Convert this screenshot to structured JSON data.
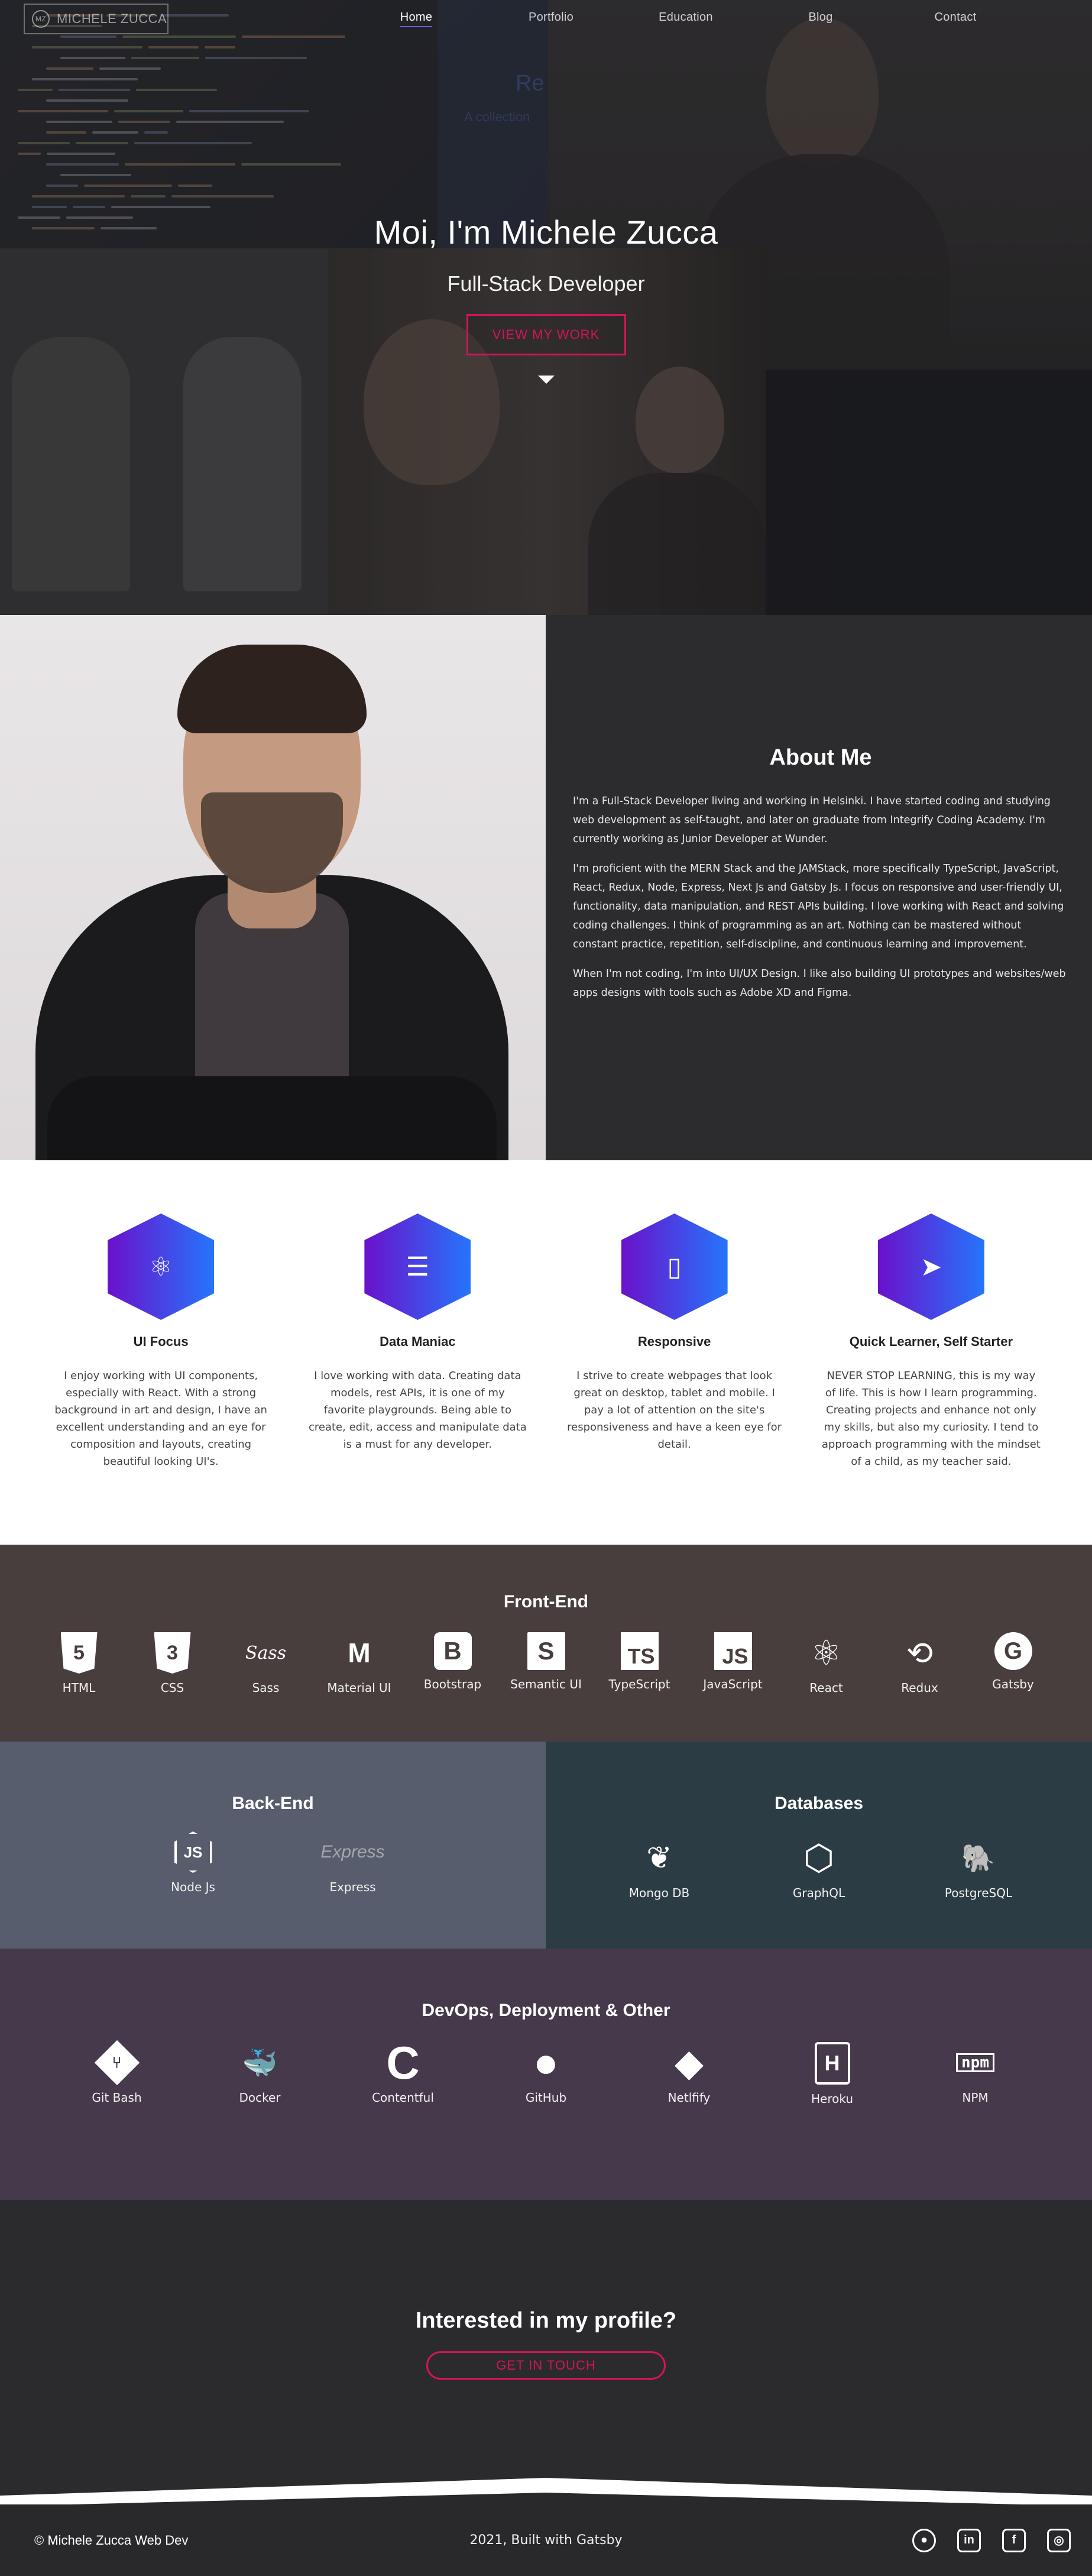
{
  "nav": {
    "logo": "MICHELE ZUCCA",
    "links": [
      "Home",
      "Portfolio",
      "Education",
      "Blog",
      "Contact"
    ]
  },
  "hero": {
    "title": "Moi, I'm Michele Zucca",
    "subtitle": "Full-Stack Developer",
    "button": "VIEW MY WORK",
    "ghost_title": "Re",
    "ghost_sub": "A collection"
  },
  "about": {
    "title": "About Me",
    "paragraphs": [
      "I'm a Full-Stack Developer living and working in Helsinki. I have started coding and studying web development as self-taught, and later on graduate from Integrify Coding Academy. I'm currently working as Junior Developer at Wunder.",
      "I'm proficient with the MERN Stack and the JAMStack, more specifically TypeScript, JavaScript, React, Redux, Node, Express, Next Js and Gatsby Js. I focus on responsive and user-friendly UI, functionality, data manipulation, and REST APIs building. I love working with React and solving coding challenges. I think of programming as an art. Nothing can be mastered without constant practice, repetition, self-discipline, and continuous learning and improvement.",
      "When I'm not coding, I'm into UI/UX Design. I like also building UI prototypes and websites/web apps designs with tools such as Adobe XD and Figma."
    ]
  },
  "features": [
    {
      "icon": "react-icon",
      "glyph": "⚛",
      "title": "UI Focus",
      "text": "I enjoy working with UI components, especially with React. With a strong background in art and design, I have an excellent understanding and an eye for composition and layouts, creating beautiful looking UI's."
    },
    {
      "icon": "database-icon",
      "glyph": "☰",
      "title": "Data Maniac",
      "text": "I love working with data. Creating data models, rest APIs, it is one of my favorite playgrounds. Being able to create, edit, access and manipulate data is a must for any developer."
    },
    {
      "icon": "mobile-icon",
      "glyph": "▯",
      "title": "Responsive",
      "text": "I strive to create webpages that look great on desktop, tablet and mobile. I pay a lot of attention on the site's responsiveness and have a keen eye for detail."
    },
    {
      "icon": "running-icon",
      "glyph": "➤",
      "title": "Quick Learner, Self Starter",
      "text": "NEVER STOP LEARNING, this is my way of life. This is how I learn programming. Creating projects and enhance not only my skills, but also my curiosity. I tend to approach programming with the mindset of a child, as my teacher said."
    }
  ],
  "frontend": {
    "title": "Front-End",
    "items": [
      {
        "icon": "html5-icon",
        "glyph": "5",
        "label": "HTML"
      },
      {
        "icon": "css3-icon",
        "glyph": "3",
        "label": "CSS"
      },
      {
        "icon": "sass-icon",
        "glyph": "Sass",
        "label": "Sass"
      },
      {
        "icon": "material-ui-icon",
        "glyph": "M",
        "label": "Material UI"
      },
      {
        "icon": "bootstrap-icon",
        "glyph": "B",
        "label": "Bootstrap"
      },
      {
        "icon": "semantic-ui-icon",
        "glyph": "S",
        "label": "Semantic UI"
      },
      {
        "icon": "typescript-icon",
        "glyph": "TS",
        "label": "TypeScript"
      },
      {
        "icon": "javascript-icon",
        "glyph": "JS",
        "label": "JavaScript"
      },
      {
        "icon": "react-icon",
        "glyph": "⚛",
        "label": "React"
      },
      {
        "icon": "redux-icon",
        "glyph": "⟲",
        "label": "Redux"
      },
      {
        "icon": "gatsby-icon",
        "glyph": "G",
        "label": "Gatsby"
      }
    ]
  },
  "backend": {
    "title": "Back-End",
    "items": [
      {
        "icon": "nodejs-icon",
        "glyph": "JS",
        "label": "Node Js"
      },
      {
        "icon": "express-icon",
        "glyph": "Express",
        "label": "Express"
      }
    ]
  },
  "databases": {
    "title": "Databases",
    "items": [
      {
        "icon": "mongodb-icon",
        "glyph": "❦",
        "label": "Mongo DB"
      },
      {
        "icon": "graphql-icon",
        "glyph": "⬡",
        "label": "GraphQL"
      },
      {
        "icon": "postgresql-icon",
        "glyph": "🐘",
        "label": "PostgreSQL"
      }
    ]
  },
  "devops": {
    "title": "DevOps, Deployment & Other",
    "items": [
      {
        "icon": "git-icon",
        "glyph": "⑂",
        "label": "Git Bash"
      },
      {
        "icon": "docker-icon",
        "glyph": "🐳",
        "label": "Docker"
      },
      {
        "icon": "contentful-icon",
        "glyph": "C",
        "label": "Contentful"
      },
      {
        "icon": "github-icon",
        "glyph": "●",
        "label": "GitHub"
      },
      {
        "icon": "netlify-icon",
        "glyph": "◆",
        "label": "Netlfify"
      },
      {
        "icon": "heroku-icon",
        "glyph": "H",
        "label": "Heroku"
      },
      {
        "icon": "npm-icon",
        "glyph": "npm",
        "label": "NPM"
      }
    ]
  },
  "contact": {
    "title": "Interested in my profile?",
    "button": "GET IN TOUCH"
  },
  "footer": {
    "copyright": "© Michele Zucca Web Dev",
    "built": "2021, Built with Gatsby",
    "social": [
      {
        "icon": "github-icon",
        "glyph": "●"
      },
      {
        "icon": "linkedin-icon",
        "glyph": "in"
      },
      {
        "icon": "facebook-icon",
        "glyph": "f"
      },
      {
        "icon": "instagram-icon",
        "glyph": "◎"
      }
    ]
  },
  "colors": {
    "accent": "#d4145a",
    "hex_gradient_start": "#6a11cb",
    "hex_gradient_end": "#2575fc",
    "frontend_bg": "#483e3d",
    "backend_bg": "#575d6c",
    "databases_bg": "#2c3c44",
    "devops_bg": "#46394b"
  }
}
